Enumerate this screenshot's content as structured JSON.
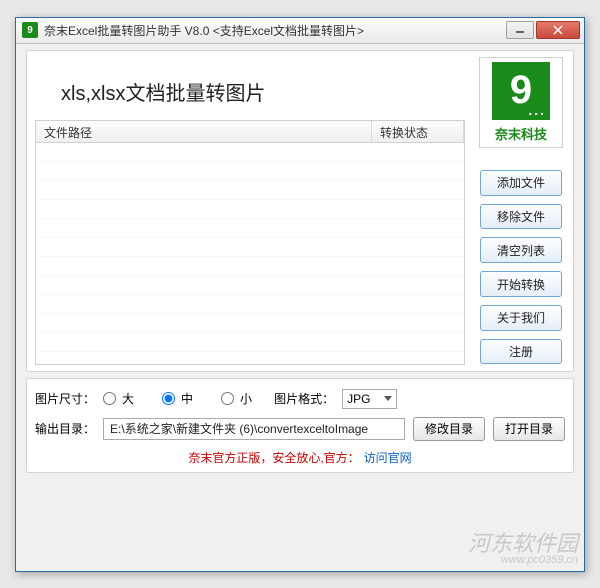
{
  "window": {
    "title": "奈末Excel批量转图片助手  V8.0   <支持Excel文档批量转图片>"
  },
  "heading": "xls,xlsx文档批量转图片",
  "logo": {
    "text": "奈末科技"
  },
  "list": {
    "col_path": "文件路径",
    "col_status": "转换状态"
  },
  "buttons": {
    "add": "添加文件",
    "remove": "移除文件",
    "clear": "清空列表",
    "start": "开始转换",
    "about": "关于我们",
    "register": "注册",
    "change_dir": "修改目录",
    "open_dir": "打开目录"
  },
  "labels": {
    "image_size": "图片尺寸：",
    "size_large": "大",
    "size_medium": "中",
    "size_small": "小",
    "image_format": "图片格式：",
    "output_dir": "输出目录："
  },
  "values": {
    "format_selected": "JPG",
    "output_path": "E:\\系统之家\\新建文件夹 (6)\\convertexceltoImage"
  },
  "footer": {
    "text": "奈末官方正版，安全放心,官方：",
    "link": "访问官网"
  },
  "watermark": {
    "name": "河东软件园",
    "url": "www.pc0359.cn"
  }
}
